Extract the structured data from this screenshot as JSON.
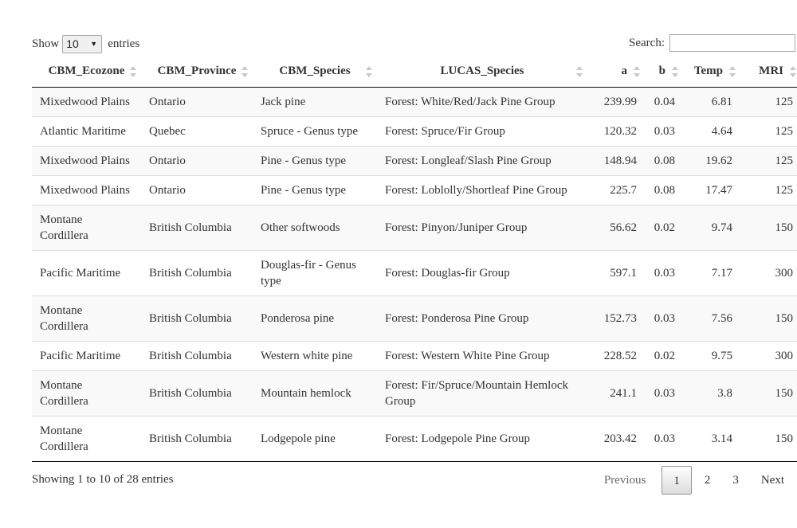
{
  "length": {
    "show_label": "Show",
    "value": "10",
    "entries_label": "entries"
  },
  "search": {
    "label": "Search:",
    "value": ""
  },
  "table": {
    "headers": [
      "CBM_Ecozone",
      "CBM_Province",
      "CBM_Species",
      "LUCAS_Species",
      "a",
      "b",
      "Temp",
      "MRI"
    ],
    "rows": [
      [
        "Mixedwood Plains",
        "Ontario",
        "Jack pine",
        "Forest: White/Red/Jack Pine Group",
        "239.99",
        "0.04",
        "6.81",
        "125"
      ],
      [
        "Atlantic Maritime",
        "Quebec",
        "Spruce - Genus type",
        "Forest: Spruce/Fir Group",
        "120.32",
        "0.03",
        "4.64",
        "125"
      ],
      [
        "Mixedwood Plains",
        "Ontario",
        "Pine - Genus type",
        "Forest: Longleaf/Slash Pine Group",
        "148.94",
        "0.08",
        "19.62",
        "125"
      ],
      [
        "Mixedwood Plains",
        "Ontario",
        "Pine - Genus type",
        "Forest: Loblolly/Shortleaf Pine Group",
        "225.7",
        "0.08",
        "17.47",
        "125"
      ],
      [
        "Montane Cordillera",
        "British Columbia",
        "Other softwoods",
        "Forest: Pinyon/Juniper Group",
        "56.62",
        "0.02",
        "9.74",
        "150"
      ],
      [
        "Pacific Maritime",
        "British Columbia",
        "Douglas-fir - Genus type",
        "Forest: Douglas-fir Group",
        "597.1",
        "0.03",
        "7.17",
        "300"
      ],
      [
        "Montane Cordillera",
        "British Columbia",
        "Ponderosa pine",
        "Forest: Ponderosa Pine Group",
        "152.73",
        "0.03",
        "7.56",
        "150"
      ],
      [
        "Pacific Maritime",
        "British Columbia",
        "Western white pine",
        "Forest: Western White Pine Group",
        "228.52",
        "0.02",
        "9.75",
        "300"
      ],
      [
        "Montane Cordillera",
        "British Columbia",
        "Mountain hemlock",
        "Forest: Fir/Spruce/Mountain Hemlock Group",
        "241.1",
        "0.03",
        "3.8",
        "150"
      ],
      [
        "Montane Cordillera",
        "British Columbia",
        "Lodgepole pine",
        "Forest: Lodgepole Pine Group",
        "203.42",
        "0.03",
        "3.14",
        "150"
      ]
    ]
  },
  "info": "Showing 1 to 10 of 28 entries",
  "pagination": {
    "previous": "Previous",
    "pages": [
      "1",
      "2",
      "3"
    ],
    "current": "1",
    "next": "Next"
  }
}
